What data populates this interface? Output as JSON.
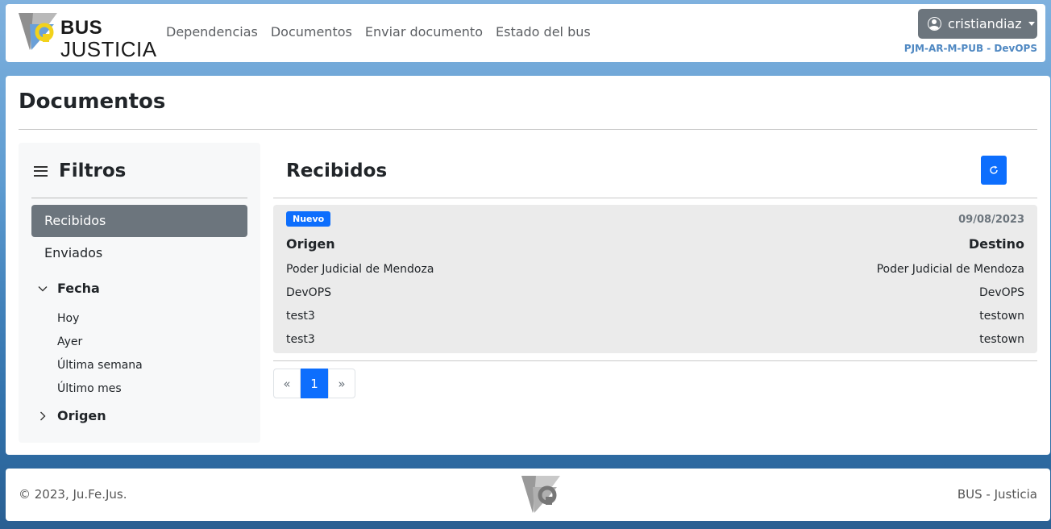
{
  "header": {
    "logo_line1": "BUS",
    "logo_line2": "JUSTICIA",
    "nav": [
      "Dependencias",
      "Documentos",
      "Enviar documento",
      "Estado del bus"
    ],
    "user": "cristiandiaz",
    "org": "PJM-AR-M-PUB - DevOPS"
  },
  "page": {
    "title": "Documentos"
  },
  "sidebar": {
    "title": "Filtros",
    "items": [
      {
        "label": "Recibidos",
        "active": true
      },
      {
        "label": "Enviados",
        "active": false
      }
    ],
    "groups": [
      {
        "label": "Fecha",
        "expanded": true,
        "items": [
          "Hoy",
          "Ayer",
          "Última semana",
          "Último mes"
        ]
      },
      {
        "label": "Origen",
        "expanded": false,
        "items": []
      }
    ]
  },
  "content": {
    "title": "Recibidos",
    "documents": [
      {
        "badge": "Nuevo",
        "date": "09/08/2023",
        "origen_label": "Origen",
        "destino_label": "Destino",
        "origen": [
          "Poder Judicial de Mendoza",
          "DevOPS",
          "test3",
          "test3"
        ],
        "destino": [
          "Poder Judicial de Mendoza",
          "DevOPS",
          "testown",
          "testown"
        ]
      }
    ],
    "pagination": {
      "prev": "«",
      "current": "1",
      "next": "»"
    }
  },
  "footer": {
    "copyright": "© 2023, Ju.Fe.Jus.",
    "right": "BUS - Justicia"
  },
  "colors": {
    "primary": "#0d6efd",
    "secondary": "#6c757d",
    "link_accent": "#4f88c2",
    "logo_yellow": "#f2d21b",
    "logo_blue": "#6aa0d8"
  }
}
